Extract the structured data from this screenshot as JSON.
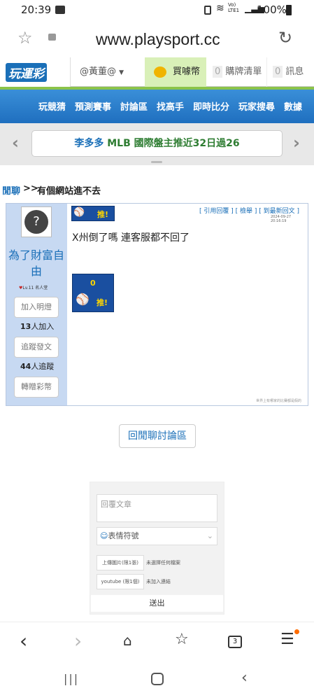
{
  "status": {
    "time": "20:39",
    "network": "Vo) LTE1",
    "battery": "100%"
  },
  "browser": {
    "url": "www.playsport.cc",
    "tabs_count": "3"
  },
  "site": {
    "logo": "玩運彩",
    "user": "@黃董@",
    "buy": "買噱幣",
    "cart_count": "0",
    "cart_label": "購牌清單",
    "msg_count": "0",
    "msg_label": "訊息",
    "menu": [
      "玩競猜",
      "預測賽事",
      "討論區",
      "找高手",
      "即時比分",
      "玩家搜尋",
      "數據"
    ]
  },
  "marquee": {
    "text_a": "李多多 ",
    "text_b": "MLB 國際盤主推近32日過26"
  },
  "breadcrumb": {
    "section": "閒聊",
    "sep": ">>",
    "title": "有個網站進不去"
  },
  "post": {
    "author": "為了財富自由",
    "level": "Lv.11 名人堂",
    "follow_btn": "加入明燈",
    "follow_count": "13",
    "follow_suffix": "人加入",
    "track_btn": "追蹤發文",
    "track_count": "44",
    "track_suffix": "人追蹤",
    "gift_btn": "轉贈彩幣",
    "push_label": "推!",
    "links": [
      "[ 引用回覆 ]",
      "[ 檢舉 ]",
      "[ 到最新回文 ]"
    ],
    "timestamp": "2024-09-27 20:16:19",
    "body": "X州倒了嗎 連客服都不回了",
    "push_count": "0",
    "push_btn_label": "推!",
    "footer_note": "世界上有哪家的比賽都是假的"
  },
  "back_btn": "回閒聊討論區",
  "reply": {
    "placeholder": "回覆文章",
    "emoji_label": "表情符號",
    "upload_btn": "上傳圖片(限1張)",
    "upload_status": "未選擇任何檔案",
    "youtube_btn": "youtube (限1個)",
    "youtube_status": "未加入連結",
    "submit": "送出"
  }
}
